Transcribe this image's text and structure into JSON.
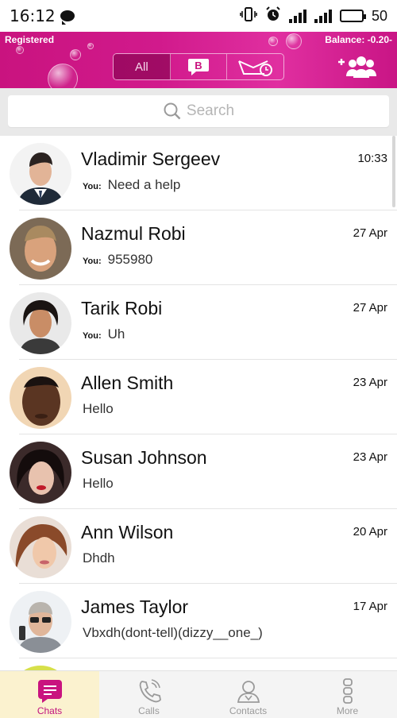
{
  "status_bar": {
    "time": "16:12",
    "battery": "50"
  },
  "header": {
    "registered": "Registered",
    "balance": "Balance: -0.20-",
    "filters": [
      "All",
      "",
      ""
    ],
    "active_filter": "All"
  },
  "search": {
    "placeholder": "Search"
  },
  "you_label": "You:",
  "chats": [
    {
      "name": "Vladimir Sergeev",
      "date": "10:33",
      "from_you": true,
      "message": "Need a help"
    },
    {
      "name": "Nazmul Robi",
      "date": "27 Apr",
      "from_you": true,
      "message": "955980"
    },
    {
      "name": "Tarik Robi",
      "date": "27 Apr",
      "from_you": true,
      "message": "Uh"
    },
    {
      "name": "Allen Smith",
      "date": "23 Apr",
      "from_you": false,
      "message": "Hello"
    },
    {
      "name": "Susan Johnson",
      "date": "23 Apr",
      "from_you": false,
      "message": "Hello"
    },
    {
      "name": "Ann Wilson",
      "date": "20 Apr",
      "from_you": false,
      "message": "Dhdh"
    },
    {
      "name": "James Taylor",
      "date": "17 Apr",
      "from_you": false,
      "message": "Vbxdh(dont-tell)(dizzy__one_)"
    }
  ],
  "nav": [
    {
      "label": "Chats",
      "icon": "chat-icon"
    },
    {
      "label": "Calls",
      "icon": "phone-icon"
    },
    {
      "label": "Contacts",
      "icon": "contacts-icon"
    },
    {
      "label": "More",
      "icon": "more-icon"
    }
  ],
  "colors": {
    "accent": "#c9137f",
    "active_tab_bg": "#fbf2cf"
  }
}
